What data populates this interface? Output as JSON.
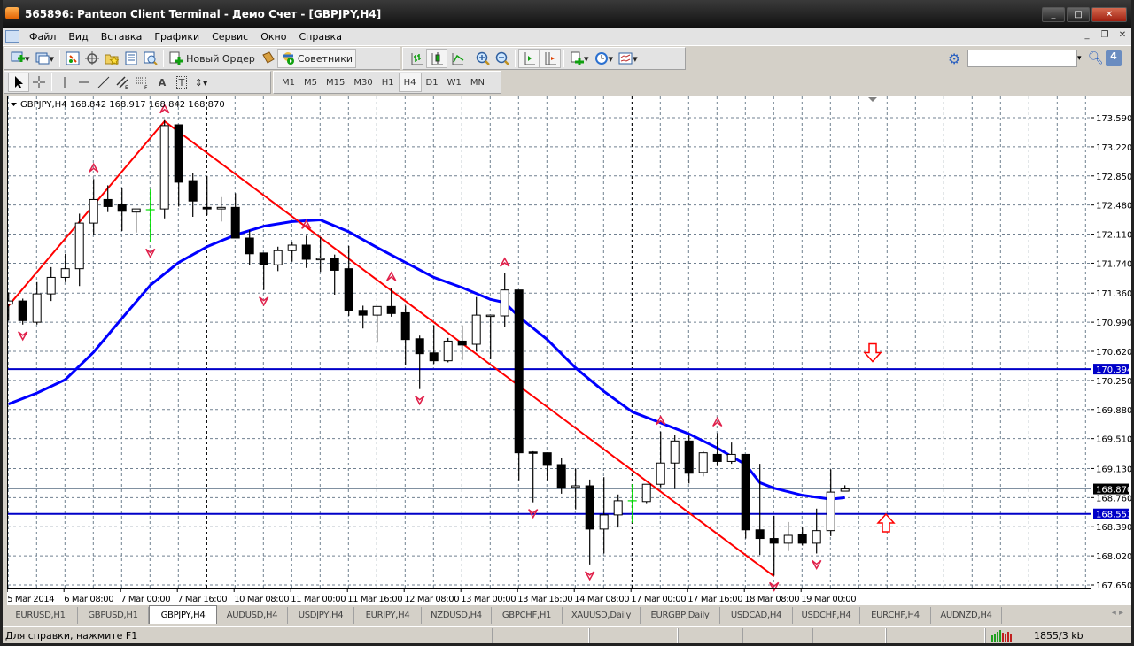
{
  "window": {
    "title": "565896: Panteon Client Terminal - Демо Счет - [GBPJPY,H4]"
  },
  "menu": [
    "Файл",
    "Вид",
    "Вставка",
    "Графики",
    "Сервис",
    "Окно",
    "Справка"
  ],
  "toolbar": {
    "new_order": "Новый Ордер",
    "experts": "Советники",
    "chat_badge": "4",
    "search_value": ""
  },
  "periods": [
    "M1",
    "M5",
    "M15",
    "M30",
    "H1",
    "H4",
    "D1",
    "W1",
    "MN"
  ],
  "active_period": "H4",
  "chart": {
    "header": "GBPJPY,H4  168.842 168.917 168.842 168.870",
    "symbol": "GBPJPY",
    "timeframe": "H4",
    "price_ticks": [
      "173.590",
      "173.220",
      "172.850",
      "172.480",
      "172.110",
      "171.740",
      "171.360",
      "170.990",
      "170.620",
      "170.250",
      "169.880",
      "169.510",
      "169.130",
      "168.760",
      "168.390",
      "168.020",
      "167.650"
    ],
    "price_range": [
      167.65,
      173.59
    ],
    "time_labels": [
      [
        "5 Mar 2014",
        0
      ],
      [
        "6 Mar 08:00",
        4
      ],
      [
        "7 Mar 00:00",
        8
      ],
      [
        "7 Mar 16:00",
        12
      ],
      [
        "10 Mar 08:00",
        16
      ],
      [
        "11 Mar 00:00",
        20
      ],
      [
        "11 Mar 16:00",
        24
      ],
      [
        "12 Mar 08:00",
        28
      ],
      [
        "13 Mar 00:00",
        32
      ],
      [
        "13 Mar 16:00",
        36
      ],
      [
        "14 Mar 08:00",
        40
      ],
      [
        "17 Mar 00:00",
        44
      ],
      [
        "17 Mar 16:00",
        48
      ],
      [
        "18 Mar 08:00",
        52
      ],
      [
        "19 Mar 00:00",
        56
      ]
    ],
    "week_separators": [
      14,
      44
    ],
    "candles_ohlc": [
      [
        171.22,
        171.37,
        171.01,
        171.26
      ],
      [
        171.26,
        171.29,
        170.96,
        171.01
      ],
      [
        170.99,
        171.5,
        170.96,
        171.35
      ],
      [
        171.35,
        171.69,
        171.26,
        171.56
      ],
      [
        171.56,
        171.86,
        171.5,
        171.67
      ],
      [
        171.67,
        172.37,
        171.45,
        172.25
      ],
      [
        172.25,
        172.81,
        172.1,
        172.55
      ],
      [
        172.55,
        172.73,
        172.39,
        172.46
      ],
      [
        172.49,
        172.7,
        172.15,
        172.4
      ],
      [
        172.39,
        172.43,
        172.13,
        172.43
      ],
      [
        172.42,
        172.68,
        172.01,
        172.42
      ],
      [
        172.43,
        173.56,
        172.31,
        173.49
      ],
      [
        173.5,
        173.5,
        172.46,
        172.77
      ],
      [
        172.79,
        172.89,
        172.33,
        172.53
      ],
      [
        172.45,
        172.85,
        172.35,
        172.43
      ],
      [
        172.43,
        172.58,
        172.27,
        172.45
      ],
      [
        172.45,
        172.63,
        172.06,
        172.06
      ],
      [
        172.06,
        172.16,
        171.72,
        171.86
      ],
      [
        171.87,
        171.87,
        171.4,
        171.72
      ],
      [
        171.72,
        171.95,
        171.64,
        171.9
      ],
      [
        171.9,
        172.01,
        171.76,
        171.97
      ],
      [
        171.97,
        172.09,
        171.68,
        171.79
      ],
      [
        171.79,
        172.07,
        171.63,
        171.8
      ],
      [
        171.8,
        171.85,
        171.34,
        171.65
      ],
      [
        171.67,
        171.96,
        171.07,
        171.14
      ],
      [
        171.14,
        171.2,
        170.91,
        171.08
      ],
      [
        171.08,
        171.19,
        170.73,
        171.19
      ],
      [
        171.19,
        171.43,
        171.06,
        171.1
      ],
      [
        171.11,
        171.2,
        170.44,
        170.77
      ],
      [
        170.78,
        170.82,
        170.14,
        170.59
      ],
      [
        170.6,
        170.95,
        170.46,
        170.5
      ],
      [
        170.5,
        170.79,
        170.48,
        170.75
      ],
      [
        170.75,
        170.95,
        170.51,
        170.7
      ],
      [
        170.71,
        171.31,
        170.62,
        171.08
      ],
      [
        171.08,
        171.08,
        170.52,
        171.08
      ],
      [
        171.07,
        171.61,
        170.93,
        171.4
      ],
      [
        171.4,
        171.4,
        168.98,
        169.33
      ],
      [
        169.34,
        169.35,
        168.7,
        169.33
      ],
      [
        169.33,
        169.33,
        168.98,
        169.17
      ],
      [
        169.18,
        169.26,
        168.81,
        168.88
      ],
      [
        168.89,
        169.13,
        168.61,
        168.91
      ],
      [
        168.91,
        168.99,
        167.91,
        168.36
      ],
      [
        168.36,
        169.02,
        168.05,
        168.54
      ],
      [
        168.54,
        168.8,
        168.38,
        168.72
      ],
      [
        168.72,
        168.93,
        168.44,
        168.72
      ],
      [
        168.71,
        168.93,
        168.69,
        168.93
      ],
      [
        168.93,
        169.6,
        168.89,
        169.2
      ],
      [
        169.2,
        169.56,
        168.87,
        169.48
      ],
      [
        169.48,
        169.56,
        168.94,
        169.07
      ],
      [
        169.08,
        169.35,
        169.03,
        169.33
      ],
      [
        169.31,
        169.58,
        169.16,
        169.22
      ],
      [
        169.22,
        169.46,
        169.19,
        169.31
      ],
      [
        169.31,
        169.31,
        168.24,
        168.35
      ],
      [
        168.35,
        169.19,
        168.03,
        168.24
      ],
      [
        168.24,
        168.53,
        167.77,
        168.18
      ],
      [
        168.18,
        168.45,
        168.08,
        168.28
      ],
      [
        168.29,
        168.38,
        168.15,
        168.18
      ],
      [
        168.18,
        168.62,
        168.05,
        168.34
      ],
      [
        168.34,
        169.12,
        168.27,
        168.83
      ],
      [
        168.842,
        168.917,
        168.842,
        168.87
      ]
    ],
    "doji_indices": [
      10,
      44
    ],
    "moving_average": [
      [
        0,
        169.95
      ],
      [
        2,
        170.09
      ],
      [
        4,
        170.26
      ],
      [
        6,
        170.61
      ],
      [
        8,
        171.04
      ],
      [
        10,
        171.46
      ],
      [
        12,
        171.75
      ],
      [
        14,
        171.95
      ],
      [
        16,
        172.1
      ],
      [
        18,
        172.21
      ],
      [
        20,
        172.27
      ],
      [
        22,
        172.29
      ],
      [
        24,
        172.14
      ],
      [
        26,
        171.94
      ],
      [
        28,
        171.75
      ],
      [
        30,
        171.56
      ],
      [
        32,
        171.43
      ],
      [
        34,
        171.28
      ],
      [
        35,
        171.24
      ],
      [
        36,
        171.06
      ],
      [
        38,
        170.77
      ],
      [
        40,
        170.41
      ],
      [
        42,
        170.11
      ],
      [
        44,
        169.85
      ],
      [
        46,
        169.71
      ],
      [
        48,
        169.57
      ],
      [
        50,
        169.39
      ],
      [
        52,
        169.18
      ],
      [
        53,
        168.95
      ],
      [
        54,
        168.88
      ],
      [
        56,
        168.79
      ],
      [
        58,
        168.74
      ],
      [
        59,
        168.76
      ]
    ],
    "zigzag": [
      [
        -0.1,
        171.18
      ],
      [
        11,
        173.545
      ],
      [
        54,
        167.76
      ]
    ],
    "fractals_up": [
      6,
      11,
      21,
      27,
      35,
      46,
      50
    ],
    "fractals_down": [
      1,
      10,
      18,
      29,
      37,
      41,
      54,
      57
    ],
    "hlines": [
      {
        "price": 170.394,
        "label": "170.394"
      },
      {
        "price": 168.553,
        "label": "168.553"
      }
    ],
    "bid": {
      "price": 168.87,
      "label": "168.870"
    },
    "arrow_down_price": 170.58,
    "arrow_up_price": 168.46,
    "colors": {
      "bg": "#ffffff",
      "grid": "#708090",
      "bull": "#ffffff",
      "bear": "#000000",
      "doji": "#00e000",
      "ma": "#0000ff",
      "zigzag": "#ff0000",
      "hline": "#0000c8",
      "fractal": "#e0204a",
      "arrow": "#ff0000"
    }
  },
  "tabs": [
    {
      "label": "EURUSD,H1"
    },
    {
      "label": "GBPUSD,H1"
    },
    {
      "label": "GBPJPY,H4",
      "active": true
    },
    {
      "label": "AUDUSD,H4"
    },
    {
      "label": "USDJPY,H4"
    },
    {
      "label": "EURJPY,H4"
    },
    {
      "label": "NZDUSD,H4"
    },
    {
      "label": "GBPCHF,H1"
    },
    {
      "label": "XAUUSD,Daily"
    },
    {
      "label": "EURGBP,Daily"
    },
    {
      "label": "USDCAD,H4"
    },
    {
      "label": "USDCHF,H4"
    },
    {
      "label": "EURCHF,H4"
    },
    {
      "label": "AUDNZD,H4"
    }
  ],
  "status": {
    "help": "Для справки, нажмите F1",
    "traffic": "1855/3 kb"
  }
}
